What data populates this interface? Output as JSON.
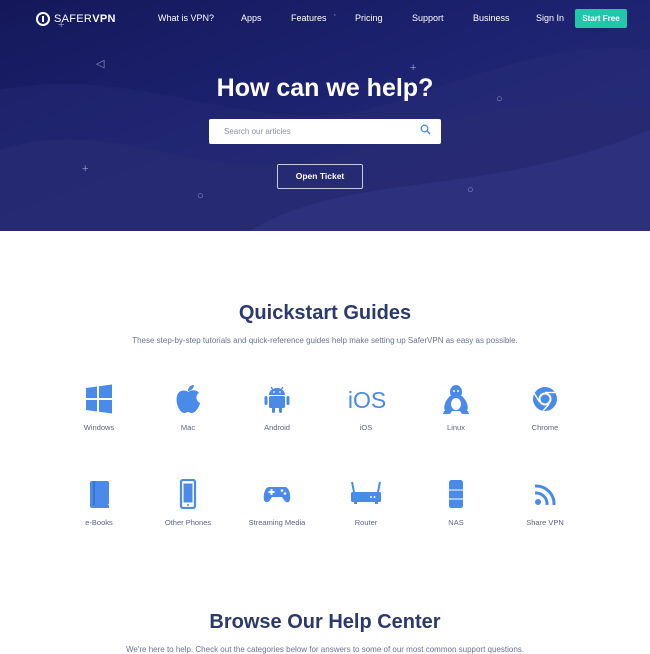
{
  "brand": {
    "logo_light": "SAFER",
    "logo_bold": "VPN"
  },
  "nav": {
    "links": [
      "What is VPN?",
      "Apps",
      "Features",
      "Pricing",
      "Support",
      "Business",
      "Sign In"
    ],
    "cta": "Start Free"
  },
  "hero": {
    "title": "How can we help?",
    "search_placeholder": "Search our articles",
    "search_value": "",
    "open_ticket": "Open Ticket"
  },
  "quickstart": {
    "title": "Quickstart Guides",
    "subtitle": "These step-by-step tutorials and quick-reference guides help make setting up SaferVPN as easy as possible.",
    "guides": [
      {
        "label": "Windows",
        "icon": "windows-icon"
      },
      {
        "label": "Mac",
        "icon": "apple-icon"
      },
      {
        "label": "Android",
        "icon": "android-icon"
      },
      {
        "label": "iOS",
        "icon": "ios-icon",
        "icon_text": "iOS"
      },
      {
        "label": "Linux",
        "icon": "linux-icon"
      },
      {
        "label": "Chrome",
        "icon": "chrome-icon"
      },
      {
        "label": "e-Books",
        "icon": "ebook-icon"
      },
      {
        "label": "Other Phones",
        "icon": "phone-icon"
      },
      {
        "label": "Streaming Media",
        "icon": "gamepad-icon"
      },
      {
        "label": "Router",
        "icon": "router-icon"
      },
      {
        "label": "NAS",
        "icon": "nas-icon"
      },
      {
        "label": "Share VPN",
        "icon": "share-icon"
      }
    ]
  },
  "browse": {
    "title": "Browse Our Help Center",
    "subtitle": "We're here to help. Check out the categories below for answers to some of our most common support questions."
  },
  "colors": {
    "hero_bg": "#1d2270",
    "accent": "#22c7a9",
    "icon_blue": "#4a8ae8",
    "heading": "#2c3a6b"
  }
}
